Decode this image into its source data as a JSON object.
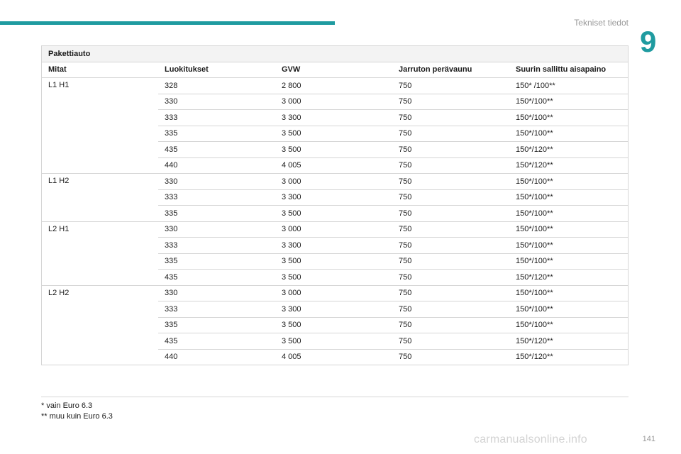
{
  "header": {
    "section_title": "Tekniset tiedot",
    "chapter_number": "9"
  },
  "table": {
    "title": "Pakettiauto",
    "columns": [
      "Mitat",
      "Luokitukset",
      "GVW",
      "Jarruton perävaunu",
      "Suurin sallittu aisapaino"
    ],
    "groups": [
      {
        "model": "L1 H1",
        "rows": [
          [
            "328",
            "2 800",
            "750",
            "150* /100**"
          ],
          [
            "330",
            "3 000",
            "750",
            "150*/100**"
          ],
          [
            "333",
            "3 300",
            "750",
            "150*/100**"
          ],
          [
            "335",
            "3 500",
            "750",
            "150*/100**"
          ],
          [
            "435",
            "3 500",
            "750",
            "150*/120**"
          ],
          [
            "440",
            "4 005",
            "750",
            "150*/120**"
          ]
        ]
      },
      {
        "model": "L1 H2",
        "rows": [
          [
            "330",
            "3 000",
            "750",
            "150*/100**"
          ],
          [
            "333",
            "3 300",
            "750",
            "150*/100**"
          ],
          [
            "335",
            "3 500",
            "750",
            "150*/100**"
          ]
        ]
      },
      {
        "model": "L2 H1",
        "rows": [
          [
            "330",
            "3 000",
            "750",
            "150*/100**"
          ],
          [
            "333",
            "3 300",
            "750",
            "150*/100**"
          ],
          [
            "335",
            "3 500",
            "750",
            "150*/100**"
          ],
          [
            "435",
            "3 500",
            "750",
            "150*/120**"
          ]
        ]
      },
      {
        "model": "L2 H2",
        "rows": [
          [
            "330",
            "3 000",
            "750",
            "150*/100**"
          ],
          [
            "333",
            "3 300",
            "750",
            "150*/100**"
          ],
          [
            "335",
            "3 500",
            "750",
            "150*/100**"
          ],
          [
            "435",
            "3 500",
            "750",
            "150*/120**"
          ],
          [
            "440",
            "4 005",
            "750",
            "150*/120**"
          ]
        ]
      }
    ]
  },
  "footnotes": [
    "* vain Euro 6.3",
    "** muu kuin Euro 6.3"
  ],
  "page_number": "141",
  "watermark": "carmanualsonline.info",
  "colors": {
    "accent": "#1f9ba0",
    "grid": "#d6d6d6",
    "title_bg": "#f3f3f3"
  }
}
